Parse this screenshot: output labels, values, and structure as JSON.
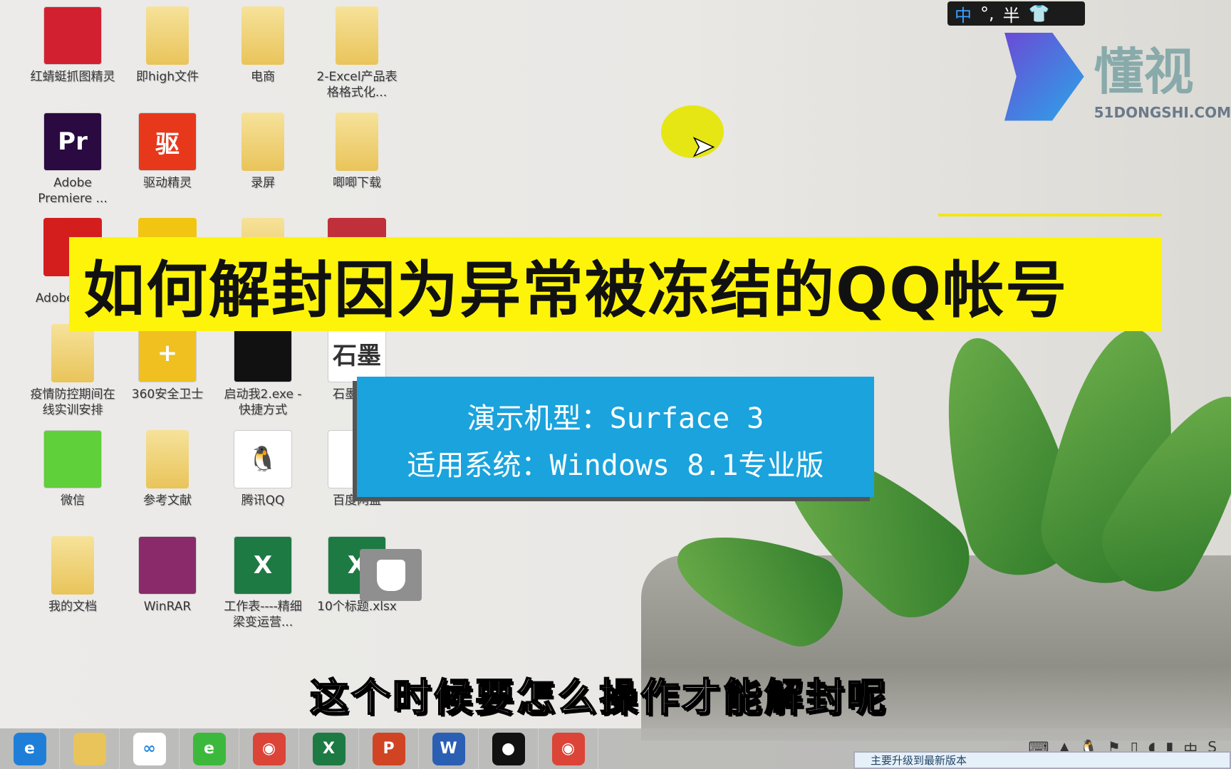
{
  "desktop_icons": [
    {
      "label": "红蜻蜓抓图精灵",
      "icon": "dragonfly-app-icon",
      "color": "#d32030"
    },
    {
      "label": "即high文件",
      "icon": "folder-icon",
      "color": "#e9c45a"
    },
    {
      "label": "电商",
      "icon": "folder-icon",
      "color": "#e9c45a"
    },
    {
      "label": "2-Excel产品表格格式化...",
      "icon": "folder-icon",
      "color": "#e9c45a"
    },
    {
      "label": "Adobe Premiere ...",
      "icon": "premiere-icon",
      "color": "#2a0a40",
      "glyph": "Pr"
    },
    {
      "label": "驱动精灵",
      "icon": "driver-genius-icon",
      "color": "#e8381c",
      "glyph": "驱"
    },
    {
      "label": "录屏",
      "icon": "folder-icon",
      "color": "#e9c45a"
    },
    {
      "label": "唧唧下载",
      "icon": "folder-icon",
      "color": "#e9c45a"
    },
    {
      "label": "Adobe Cre...",
      "icon": "creative-cloud-icon",
      "color": "#d41e1e"
    },
    {
      "label": "",
      "icon": "app-icon",
      "color": "#f2c512"
    },
    {
      "label": "",
      "icon": "folder-icon",
      "color": "#e9c45a"
    },
    {
      "label": "",
      "icon": "app-icon",
      "color": "#c0303a"
    },
    {
      "label": "疫情防控期间在线实训安排",
      "icon": "folder-icon",
      "color": "#e9c45a"
    },
    {
      "label": "360安全卫士",
      "icon": "360-icon",
      "color": "#f0c020",
      "glyph": "+"
    },
    {
      "label": "启动我2.exe - 快捷方式",
      "icon": "record-app-icon",
      "color": "#111"
    },
    {
      "label": "石墨文档",
      "icon": "shimo-icon",
      "color": "#ffffff",
      "glyph": "石墨"
    },
    {
      "label": "微信",
      "icon": "wechat-icon",
      "color": "#5fcf3a"
    },
    {
      "label": "参考文献",
      "icon": "folder-icon",
      "color": "#e9c45a"
    },
    {
      "label": "腾讯QQ",
      "icon": "qq-icon",
      "color": "#ffffff",
      "glyph": "🐧"
    },
    {
      "label": "百度网盘",
      "icon": "baidu-netdisk-icon",
      "color": "#ffffff"
    },
    {
      "label": "我的文档",
      "icon": "folder-icon",
      "color": "#e9c45a"
    },
    {
      "label": "WinRAR",
      "icon": "winrar-icon",
      "color": "#8a2a6a"
    },
    {
      "label": "工作表----精细梁变运营...",
      "icon": "excel-file-icon",
      "color": "#1d7a43",
      "glyph": "X"
    },
    {
      "label": "10个标题.xlsx",
      "icon": "excel-file-icon",
      "color": "#1d7a43",
      "glyph": "X"
    }
  ],
  "banner_title": "如何解封因为异常被冻结的QQ帐号",
  "info": {
    "line1": "演示机型：Surface 3",
    "line2": "适用系统：Windows 8.1专业版"
  },
  "subtitle": "这个时候要怎么操作才能解封呢",
  "ime": {
    "mode": "中",
    "punct": "°,",
    "width": "半"
  },
  "logo": {
    "name": "懂视",
    "url_text": "51DONGSHI.COM"
  },
  "taskbar": [
    {
      "name": "internet-explorer",
      "color": "#1f7fd8",
      "glyph": "e"
    },
    {
      "name": "file-explorer",
      "color": "#e9c45a",
      "glyph": ""
    },
    {
      "name": "baidu-netdisk",
      "color": "#ffffff",
      "glyph": "∞"
    },
    {
      "name": "360-browser",
      "color": "#3cb93c",
      "glyph": "e"
    },
    {
      "name": "chrome",
      "color": "#db4437",
      "glyph": "◉"
    },
    {
      "name": "excel",
      "color": "#1d7a43",
      "glyph": "X"
    },
    {
      "name": "powerpoint",
      "color": "#d04423",
      "glyph": "P"
    },
    {
      "name": "word",
      "color": "#2b5fb4",
      "glyph": "W"
    },
    {
      "name": "recorder",
      "color": "#111111",
      "glyph": "●"
    },
    {
      "name": "chrome-2",
      "color": "#db4437",
      "glyph": "◉"
    }
  ],
  "tray": [
    "⌨",
    "▲",
    "🐧",
    "⚑",
    "▯",
    "◖",
    "▮",
    "中",
    "S"
  ],
  "notification": "主要升级到最新版本"
}
